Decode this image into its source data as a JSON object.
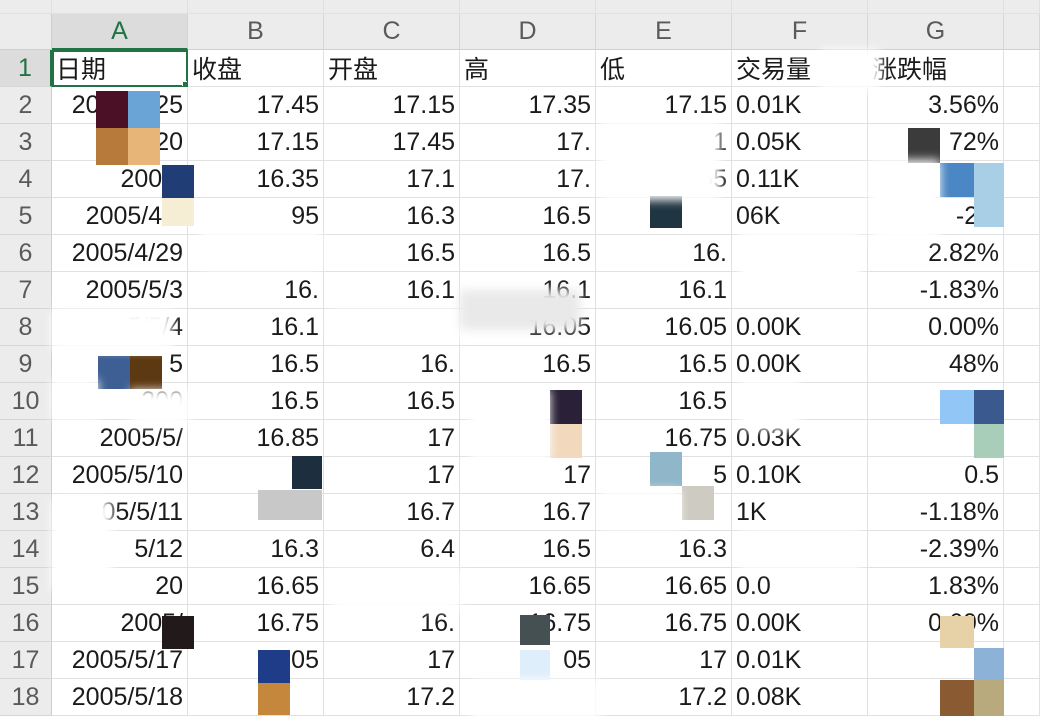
{
  "column_headers": [
    "A",
    "B",
    "C",
    "D",
    "E",
    "F",
    "G"
  ],
  "selected_cell": "A1",
  "accent_color": "#217346",
  "rows": [
    {
      "n": "1",
      "cells": [
        "日期",
        "收盘",
        "开盘",
        "高",
        "低",
        "交易量",
        "涨跌幅"
      ]
    },
    {
      "n": "2",
      "cells": [
        "2005/4/25",
        "17.45",
        "17.15",
        "17.35",
        "17.15",
        "0.01K",
        "3.56%"
      ]
    },
    {
      "n": "3",
      "cells": [
        "20",
        "17.15",
        "17.45",
        "17.",
        "17.1",
        "0.05K",
        "72%"
      ]
    },
    {
      "n": "4",
      "cells": [
        "2005/",
        "16.35",
        "17.1",
        "17.",
        "55",
        "0.11K",
        ""
      ]
    },
    {
      "n": "5",
      "cells": [
        "2005/4/2",
        "95",
        "16.3",
        "16.5",
        "",
        "06K",
        "-2.4"
      ]
    },
    {
      "n": "6",
      "cells": [
        "2005/4/29",
        "",
        "16.5",
        "16.5",
        "16.",
        "",
        "2.82%"
      ]
    },
    {
      "n": "7",
      "cells": [
        "2005/5/3",
        "16.",
        "16.1",
        "16.1",
        "16.1",
        "",
        "-1.83%"
      ]
    },
    {
      "n": "8",
      "cells": [
        "5/5/4",
        "16.1",
        "",
        "16.05",
        "16.05",
        "0.00K",
        "0.00%"
      ]
    },
    {
      "n": "9",
      "cells": [
        "5",
        "16.5",
        "16.",
        "16.5",
        "16.5",
        "0.00K",
        "48%"
      ]
    },
    {
      "n": "10",
      "cells": [
        "200",
        "16.5",
        "16.5",
        "",
        "16.5",
        "",
        "%"
      ]
    },
    {
      "n": "11",
      "cells": [
        "2005/5/",
        "16.85",
        "17",
        "",
        "16.75",
        "0.03K",
        "2"
      ]
    },
    {
      "n": "12",
      "cells": [
        "2005/5/10",
        "5",
        "17",
        "17",
        "5",
        "0.10K",
        "0.5"
      ]
    },
    {
      "n": "13",
      "cells": [
        "05/5/11",
        "1",
        "16.7",
        "16.7",
        "",
        "1K",
        "-1.18%"
      ]
    },
    {
      "n": "14",
      "cells": [
        "5/12",
        "16.3",
        "6.4",
        "16.5",
        "16.3",
        "",
        "-2.39%"
      ]
    },
    {
      "n": "15",
      "cells": [
        "20",
        "16.65",
        "",
        "16.65",
        "16.65",
        "0.0",
        "1.83%"
      ]
    },
    {
      "n": "16",
      "cells": [
        "2005/",
        "16.75",
        "16.",
        "16.75",
        "16.75",
        "0.00K",
        "0.60%"
      ]
    },
    {
      "n": "17",
      "cells": [
        "2005/5/17",
        "7.05",
        "17",
        "05",
        "17",
        "0.01K",
        ""
      ]
    },
    {
      "n": "18",
      "cells": [
        "2005/5/18",
        "",
        "17.2",
        "",
        "17.2",
        "0.08K",
        "1."
      ]
    }
  ]
}
